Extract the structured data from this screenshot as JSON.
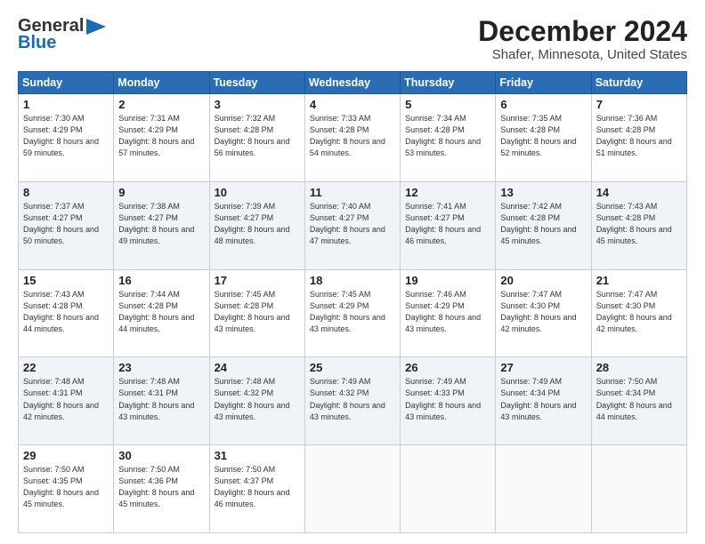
{
  "logo": {
    "line1": "General",
    "line2": "Blue"
  },
  "title": "December 2024",
  "subtitle": "Shafer, Minnesota, United States",
  "days_header": [
    "Sunday",
    "Monday",
    "Tuesday",
    "Wednesday",
    "Thursday",
    "Friday",
    "Saturday"
  ],
  "weeks": [
    [
      {
        "day": "1",
        "sunrise": "7:30 AM",
        "sunset": "4:29 PM",
        "daylight": "8 hours and 59 minutes."
      },
      {
        "day": "2",
        "sunrise": "7:31 AM",
        "sunset": "4:29 PM",
        "daylight": "8 hours and 57 minutes."
      },
      {
        "day": "3",
        "sunrise": "7:32 AM",
        "sunset": "4:28 PM",
        "daylight": "8 hours and 56 minutes."
      },
      {
        "day": "4",
        "sunrise": "7:33 AM",
        "sunset": "4:28 PM",
        "daylight": "8 hours and 54 minutes."
      },
      {
        "day": "5",
        "sunrise": "7:34 AM",
        "sunset": "4:28 PM",
        "daylight": "8 hours and 53 minutes."
      },
      {
        "day": "6",
        "sunrise": "7:35 AM",
        "sunset": "4:28 PM",
        "daylight": "8 hours and 52 minutes."
      },
      {
        "day": "7",
        "sunrise": "7:36 AM",
        "sunset": "4:28 PM",
        "daylight": "8 hours and 51 minutes."
      }
    ],
    [
      {
        "day": "8",
        "sunrise": "7:37 AM",
        "sunset": "4:27 PM",
        "daylight": "8 hours and 50 minutes."
      },
      {
        "day": "9",
        "sunrise": "7:38 AM",
        "sunset": "4:27 PM",
        "daylight": "8 hours and 49 minutes."
      },
      {
        "day": "10",
        "sunrise": "7:39 AM",
        "sunset": "4:27 PM",
        "daylight": "8 hours and 48 minutes."
      },
      {
        "day": "11",
        "sunrise": "7:40 AM",
        "sunset": "4:27 PM",
        "daylight": "8 hours and 47 minutes."
      },
      {
        "day": "12",
        "sunrise": "7:41 AM",
        "sunset": "4:27 PM",
        "daylight": "8 hours and 46 minutes."
      },
      {
        "day": "13",
        "sunrise": "7:42 AM",
        "sunset": "4:28 PM",
        "daylight": "8 hours and 45 minutes."
      },
      {
        "day": "14",
        "sunrise": "7:43 AM",
        "sunset": "4:28 PM",
        "daylight": "8 hours and 45 minutes."
      }
    ],
    [
      {
        "day": "15",
        "sunrise": "7:43 AM",
        "sunset": "4:28 PM",
        "daylight": "8 hours and 44 minutes."
      },
      {
        "day": "16",
        "sunrise": "7:44 AM",
        "sunset": "4:28 PM",
        "daylight": "8 hours and 44 minutes."
      },
      {
        "day": "17",
        "sunrise": "7:45 AM",
        "sunset": "4:28 PM",
        "daylight": "8 hours and 43 minutes."
      },
      {
        "day": "18",
        "sunrise": "7:45 AM",
        "sunset": "4:29 PM",
        "daylight": "8 hours and 43 minutes."
      },
      {
        "day": "19",
        "sunrise": "7:46 AM",
        "sunset": "4:29 PM",
        "daylight": "8 hours and 43 minutes."
      },
      {
        "day": "20",
        "sunrise": "7:47 AM",
        "sunset": "4:30 PM",
        "daylight": "8 hours and 42 minutes."
      },
      {
        "day": "21",
        "sunrise": "7:47 AM",
        "sunset": "4:30 PM",
        "daylight": "8 hours and 42 minutes."
      }
    ],
    [
      {
        "day": "22",
        "sunrise": "7:48 AM",
        "sunset": "4:31 PM",
        "daylight": "8 hours and 42 minutes."
      },
      {
        "day": "23",
        "sunrise": "7:48 AM",
        "sunset": "4:31 PM",
        "daylight": "8 hours and 43 minutes."
      },
      {
        "day": "24",
        "sunrise": "7:48 AM",
        "sunset": "4:32 PM",
        "daylight": "8 hours and 43 minutes."
      },
      {
        "day": "25",
        "sunrise": "7:49 AM",
        "sunset": "4:32 PM",
        "daylight": "8 hours and 43 minutes."
      },
      {
        "day": "26",
        "sunrise": "7:49 AM",
        "sunset": "4:33 PM",
        "daylight": "8 hours and 43 minutes."
      },
      {
        "day": "27",
        "sunrise": "7:49 AM",
        "sunset": "4:34 PM",
        "daylight": "8 hours and 43 minutes."
      },
      {
        "day": "28",
        "sunrise": "7:50 AM",
        "sunset": "4:34 PM",
        "daylight": "8 hours and 44 minutes."
      }
    ],
    [
      {
        "day": "29",
        "sunrise": "7:50 AM",
        "sunset": "4:35 PM",
        "daylight": "8 hours and 45 minutes."
      },
      {
        "day": "30",
        "sunrise": "7:50 AM",
        "sunset": "4:36 PM",
        "daylight": "8 hours and 45 minutes."
      },
      {
        "day": "31",
        "sunrise": "7:50 AM",
        "sunset": "4:37 PM",
        "daylight": "8 hours and 46 minutes."
      },
      null,
      null,
      null,
      null
    ]
  ],
  "labels": {
    "sunrise": "Sunrise:",
    "sunset": "Sunset:",
    "daylight": "Daylight:"
  }
}
